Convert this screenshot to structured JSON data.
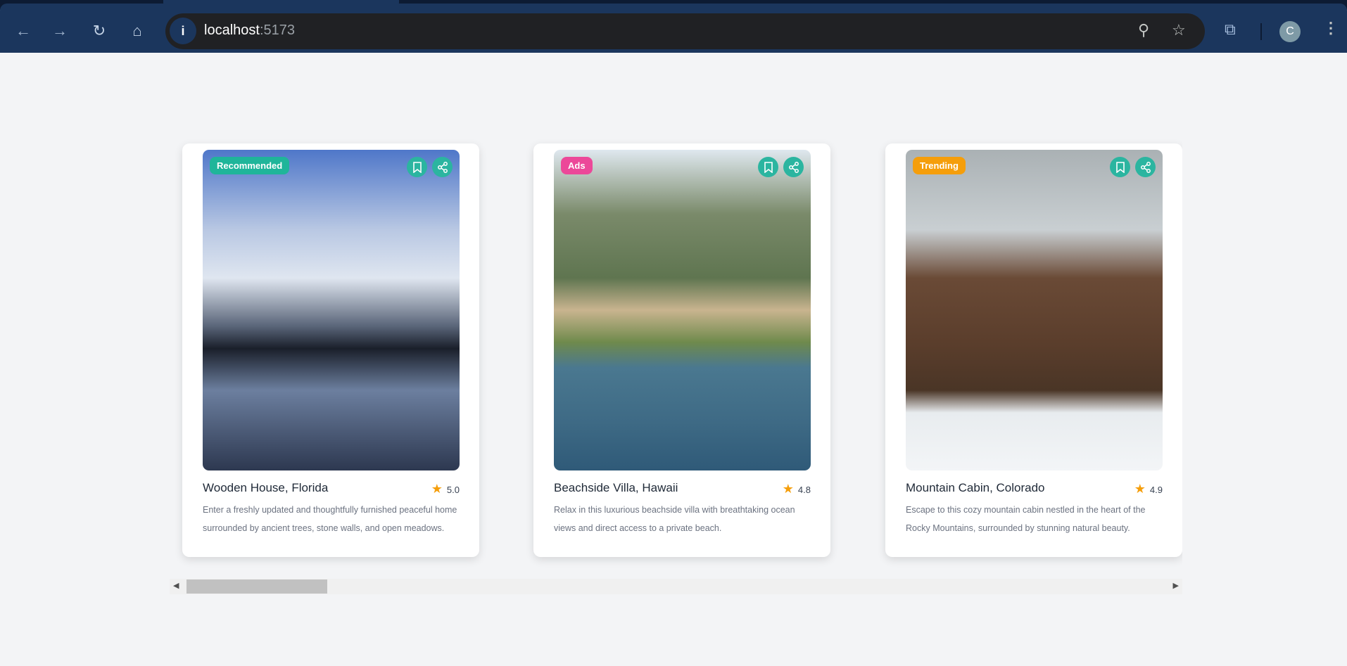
{
  "browser": {
    "url_host": "localhost",
    "url_port": ":5173",
    "avatar_letter": "C"
  },
  "cards": [
    {
      "badge": "Recommended",
      "badge_color": "#1fb59a",
      "title": "Wooden House, Florida",
      "rating": "5.0",
      "description": "Enter a freshly updated and thoughtfully furnished peaceful home surrounded by ancient trees, stone walls, and open meadows."
    },
    {
      "badge": "Ads",
      "badge_color": "#ec4899",
      "title": "Beachside Villa, Hawaii",
      "rating": "4.8",
      "description": "Relax in this luxurious beachside villa with breathtaking ocean views and direct access to a private beach."
    },
    {
      "badge": "Trending",
      "badge_color": "#f59e0b",
      "title": "Mountain Cabin, Colorado",
      "rating": "4.9",
      "description": "Escape to this cozy mountain cabin nestled in the heart of the Rocky Mountains, surrounded by stunning natural beauty."
    }
  ],
  "accent": "#2bb5a0"
}
